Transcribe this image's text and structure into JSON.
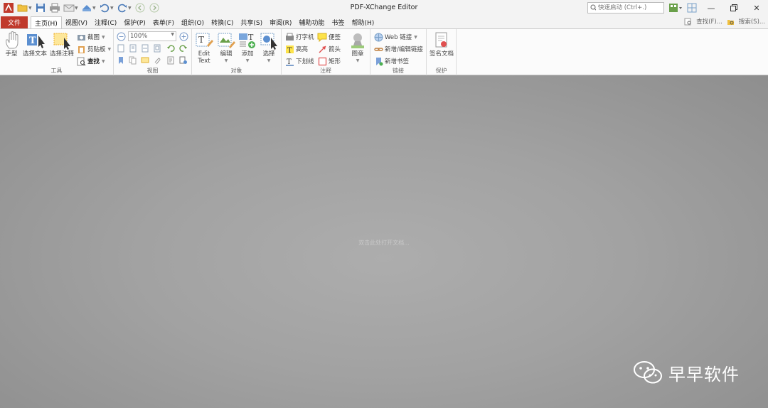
{
  "titlebar": {
    "app_title": "PDF-XChange Editor",
    "quick_launch_placeholder": "快速启动 (Ctrl+.)",
    "qat_icons": [
      "app-logo-icon",
      "open-folder-icon",
      "save-icon",
      "print-icon",
      "email-icon",
      "scan-icon",
      "undo-icon",
      "redo-icon",
      "back-icon",
      "forward-icon"
    ]
  },
  "menubar": {
    "file_label": "文件",
    "items": [
      {
        "label": "主页(H)",
        "active": true
      },
      {
        "label": "视图(V)"
      },
      {
        "label": "注释(C)"
      },
      {
        "label": "保护(P)"
      },
      {
        "label": "表单(F)"
      },
      {
        "label": "组织(O)"
      },
      {
        "label": "转换(C)"
      },
      {
        "label": "共享(S)"
      },
      {
        "label": "审阅(R)"
      },
      {
        "label": "辅助功能"
      },
      {
        "label": "书签"
      },
      {
        "label": "帮助(H)"
      }
    ],
    "find_label": "查找(F)...",
    "search_label": "搜索(S)..."
  },
  "ribbon": {
    "tools": {
      "label": "工具",
      "hand": "手型",
      "select_text": "选择文本",
      "select_comment": "选择注释",
      "snapshot": "截图",
      "clipboard": "剪贴板",
      "find": "查找"
    },
    "view": {
      "label": "视图",
      "zoom": "100%"
    },
    "objects": {
      "label": "对象",
      "edit_text_1": "Edit",
      "edit_text_2": "Text",
      "edit": "编辑",
      "add": "添加",
      "select": "选择"
    },
    "comments": {
      "label": "注释",
      "typewriter": "打字机",
      "highlight": "高亮",
      "underline": "下划线",
      "sticky": "便签",
      "arrow": "箭头",
      "rectangle": "矩形",
      "stamp": "图章"
    },
    "links": {
      "label": "链接",
      "web_links": "Web 链接",
      "add_edit_link": "新增/编辑链接",
      "add_bookmark": "新增书签"
    },
    "protect": {
      "label": "保护",
      "sign": "签名文档"
    }
  },
  "document": {
    "welcome": "双击此处打开文档..."
  },
  "watermark": {
    "text": "早早软件"
  },
  "colors": {
    "accent": "#c0392b",
    "doc_bg": "#a6a6a6"
  }
}
